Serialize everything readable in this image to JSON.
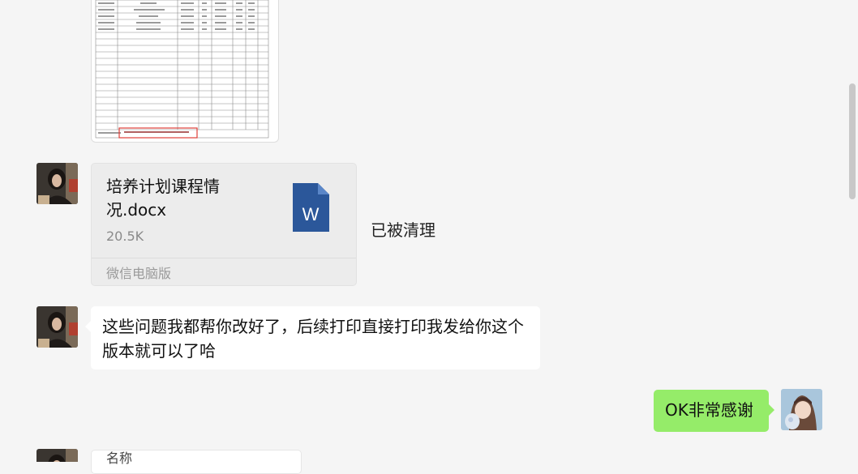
{
  "file_message": {
    "file_name": "培养计划课程情况.docx",
    "file_size": "20.5K",
    "source": "微信电脑版",
    "status": "已被清理",
    "file_icon_letter": "W",
    "file_icon_color": "#2b579a"
  },
  "text_message": {
    "text": "这些问题我都帮你改好了，后续打印直接打印我发给你这个版本就可以了哈"
  },
  "my_message": {
    "text": "OK非常感谢",
    "bubble_color": "#95ec69"
  },
  "partial_card": {
    "label": "名称"
  }
}
